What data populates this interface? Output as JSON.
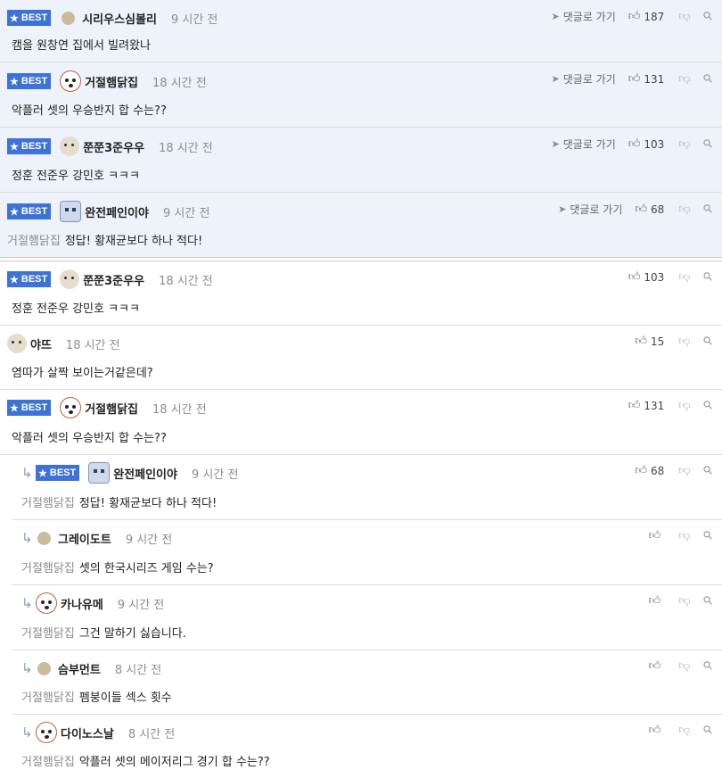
{
  "ui": {
    "goto_label": "댓글로 가기",
    "best_label": "BEST"
  },
  "top_best": [
    {
      "author": "시리우스심볼리",
      "avatar": "plain",
      "time": "9 시간 전",
      "likes": "187",
      "mention": "",
      "text": "캠을 원창연 집에서 빌려왔나"
    },
    {
      "author": "거절햄닭집",
      "avatar": "dog",
      "time": "18 시간 전",
      "likes": "131",
      "mention": "",
      "text": "악플러 셋의 우승반지 합 수는??"
    },
    {
      "author": "쭌쭌3준우우",
      "avatar": "puppy",
      "time": "18 시간 전",
      "likes": "103",
      "mention": "",
      "text": "정훈 전준우 강민호 ㅋㅋㅋ"
    },
    {
      "author": "완전페인이야",
      "avatar": "robot",
      "time": "9 시간 전",
      "likes": "68",
      "mention": "거절햄닭집",
      "text": "정답! 황재균보다 하나 적다!"
    }
  ],
  "comments": [
    {
      "author": "쭌쭌3준우우",
      "avatar": "puppy",
      "time": "18 시간 전",
      "likes": "103",
      "best": true,
      "reply": false,
      "mention": "",
      "text": "정훈 전준우 강민호 ㅋㅋㅋ"
    },
    {
      "author": "야뜨",
      "avatar": "puppy",
      "time": "18 시간 전",
      "likes": "15",
      "best": false,
      "reply": false,
      "mention": "",
      "text": "염따가 살짝 보이는거같은데?"
    },
    {
      "author": "거절햄닭집",
      "avatar": "dog",
      "time": "18 시간 전",
      "likes": "131",
      "best": true,
      "reply": false,
      "mention": "",
      "text": "악플러 셋의 우승반지 합 수는??"
    },
    {
      "author": "완전페인이야",
      "avatar": "robot",
      "time": "9 시간 전",
      "likes": "68",
      "best": true,
      "reply": true,
      "mention": "거절햄닭집",
      "text": "정답! 황재균보다 하나 적다!"
    },
    {
      "author": "그레이도트",
      "avatar": "plain",
      "time": "9 시간 전",
      "likes": "",
      "best": false,
      "reply": true,
      "mention": "거절햄닭집",
      "text": "셋의 한국시리즈 게임 수는?"
    },
    {
      "author": "카나유메",
      "avatar": "dog",
      "time": "9 시간 전",
      "likes": "",
      "best": false,
      "reply": true,
      "mention": "거절햄닭집",
      "text": "그건 말하기 싫습니다."
    },
    {
      "author": "슴부먼트",
      "avatar": "plain",
      "time": "8 시간 전",
      "likes": "",
      "best": false,
      "reply": true,
      "mention": "거절햄닭집",
      "text": "펨붕이들 섹스 횟수"
    },
    {
      "author": "다이노스날",
      "avatar": "dog",
      "time": "8 시간 전",
      "likes": "",
      "best": false,
      "reply": true,
      "mention": "거절햄닭집",
      "text": "악플러 셋의 메이저리그 경기 합 수는??"
    }
  ]
}
